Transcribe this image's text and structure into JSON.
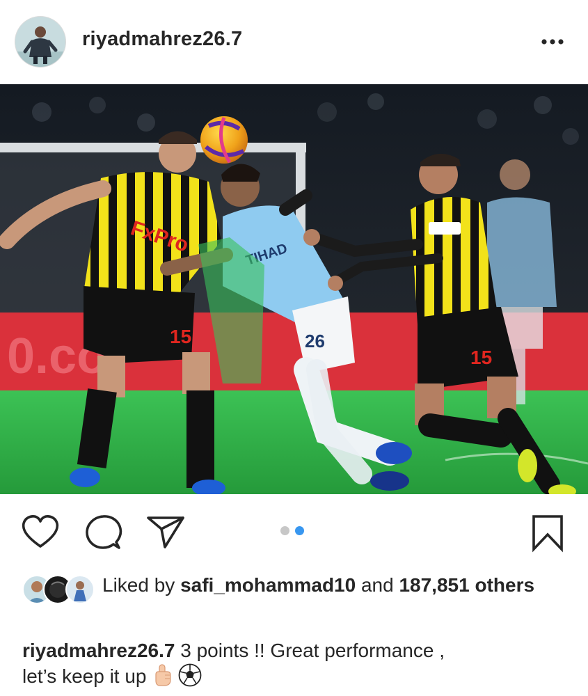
{
  "post": {
    "username": "riyadmahrez26.7",
    "carousel_total": 2,
    "carousel_active": 2
  },
  "likes": {
    "prefix": "Liked by",
    "user": "safi_mohammad10",
    "joiner": "and",
    "count": "187,851",
    "suffix": "others"
  },
  "caption": {
    "username": "riyadmahrez26.7",
    "text_line1": "3 points !! Great performance ,",
    "text_line2": "let’s keep it up"
  },
  "photo": {
    "jersey_numbers": [
      "15",
      "26",
      "15"
    ],
    "sponsor": "FxPro"
  },
  "colors": {
    "text": "#262626",
    "dot_active": "#3897f0",
    "dot_inactive": "#c7c7c7",
    "pitch": "#2fb84a",
    "ad_board": "#d7202b"
  }
}
